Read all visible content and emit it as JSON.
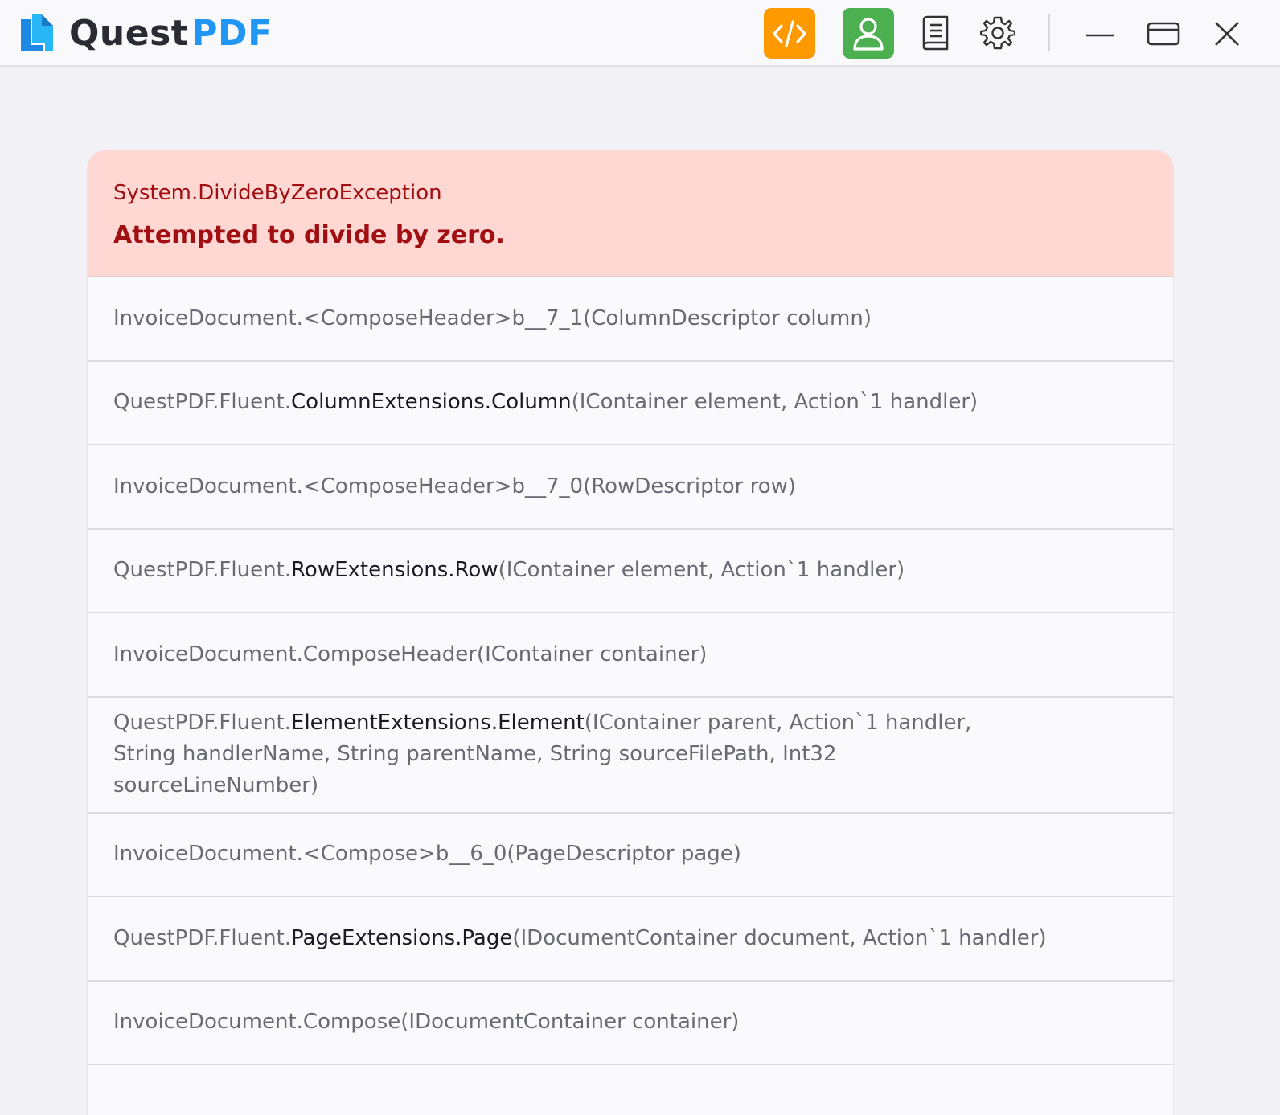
{
  "app": {
    "name_part1": "Quest",
    "name_part2": "PDF",
    "colors": {
      "brand_blue": "#2196f3",
      "code_button": "#ff9900",
      "user_button": "#4caf50",
      "error_background": "#ffd7d3",
      "error_text": "#a10f12"
    }
  },
  "toolbar": {
    "icons": [
      "code-icon",
      "user-icon",
      "book-icon",
      "gear-icon",
      "minimize-icon",
      "maximize-icon",
      "close-icon"
    ]
  },
  "error": {
    "type": "System.DivideByZeroException",
    "message": "Attempted to divide by zero."
  },
  "stack": [
    {
      "prefix": "InvoiceDocument.<ComposeHeader>b__7_1(ColumnDescriptor column)",
      "highlight": "",
      "suffix": ""
    },
    {
      "prefix": "QuestPDF.Fluent.",
      "highlight": "ColumnExtensions.Column",
      "suffix": "(IContainer element, Action`1 handler)"
    },
    {
      "prefix": "InvoiceDocument.<ComposeHeader>b__7_0(RowDescriptor row)",
      "highlight": "",
      "suffix": ""
    },
    {
      "prefix": "QuestPDF.Fluent.",
      "highlight": "RowExtensions.Row",
      "suffix": "(IContainer element, Action`1 handler)"
    },
    {
      "prefix": "InvoiceDocument.ComposeHeader(IContainer container)",
      "highlight": "",
      "suffix": ""
    },
    {
      "prefix": "QuestPDF.Fluent.",
      "highlight": "ElementExtensions.Element",
      "suffix": "(IContainer parent, Action`1 handler, String handlerName, String parentName, String sourceFilePath, Int32 sourceLineNumber)"
    },
    {
      "prefix": "InvoiceDocument.<Compose>b__6_0(PageDescriptor page)",
      "highlight": "",
      "suffix": ""
    },
    {
      "prefix": "QuestPDF.Fluent.",
      "highlight": "PageExtensions.Page",
      "suffix": "(IDocumentContainer document, Action`1 handler)"
    },
    {
      "prefix": "InvoiceDocument.Compose(IDocumentContainer container)",
      "highlight": "",
      "suffix": ""
    }
  ]
}
